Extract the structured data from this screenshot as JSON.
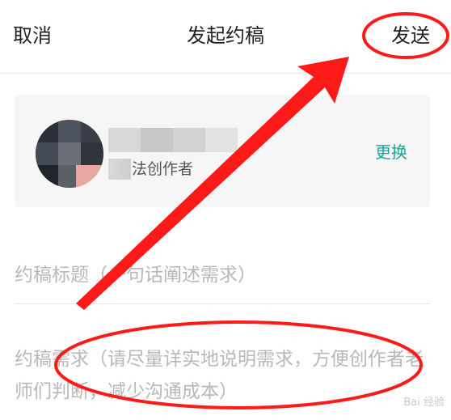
{
  "header": {
    "cancel_label": "取消",
    "title": "发起约稿",
    "send_label": "发送"
  },
  "author_card": {
    "tag_text": "方法创作者",
    "change_label": "更换"
  },
  "form": {
    "title_placeholder": "约稿标题（一句话阐述需求）",
    "title_value": "",
    "requirement_placeholder": "约稿需求（请尽量详实地说明需求，方便创作者老师们判断，减少沟通成本）",
    "requirement_value": ""
  },
  "annotation": {
    "color": "#ff1a1a"
  },
  "colors": {
    "accent": "#1aa39a",
    "placeholder": "#b8b8b8",
    "card_bg": "#f6f6f6"
  },
  "watermark": {
    "text": "Bai 经验"
  }
}
